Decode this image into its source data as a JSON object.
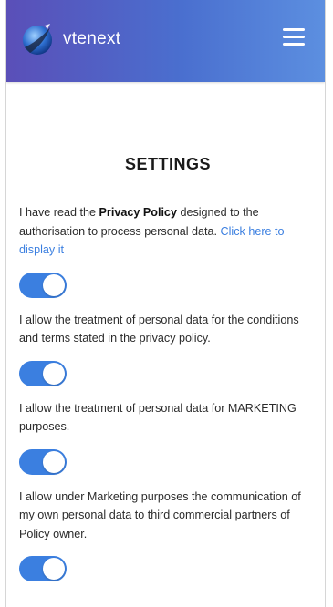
{
  "navbar": {
    "brand": "vtenext",
    "logo_icon": "vtenext-logo-icon",
    "menu_icon": "hamburger-menu-icon",
    "colors": {
      "gradient_start": "#5a4fb8",
      "gradient_end": "#5c8fe0"
    }
  },
  "page": {
    "title": "SETTINGS"
  },
  "consents": [
    {
      "text_before": "I have read the ",
      "text_bold": "Privacy Policy",
      "text_after": " designed to the authorisation to process personal data. ",
      "link": "Click here to display it",
      "toggle_on": true
    },
    {
      "text": "I allow the treatment of personal data for the conditions and terms stated in the privacy policy.",
      "toggle_on": true
    },
    {
      "text": "I allow the treatment of personal data for MARKETING purposes.",
      "toggle_on": true
    },
    {
      "text": "I allow under Marketing purposes the communication of my own personal data to third commercial partners of Policy owner.",
      "toggle_on": true
    }
  ],
  "colors": {
    "accent": "#3b7fe0",
    "toggle_on": "#3b7fe0",
    "toggle_off": "#cccccc"
  }
}
